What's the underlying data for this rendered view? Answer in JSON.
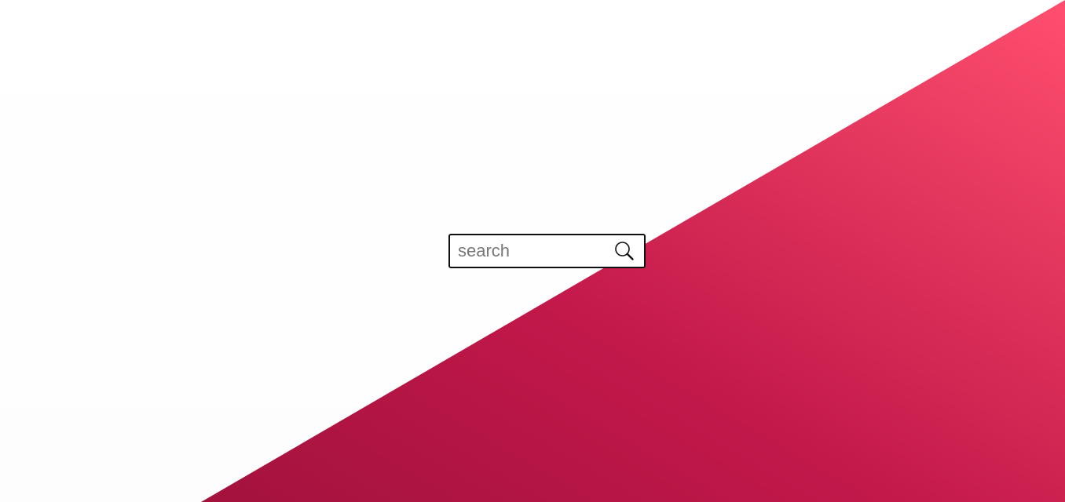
{
  "background": {
    "base_color": "#ffffff",
    "gradient_colors": [
      "#a3123d",
      "#c2184a",
      "#ff4f6e"
    ]
  },
  "search": {
    "placeholder": "search",
    "value": "",
    "button_icon": "search-icon"
  }
}
